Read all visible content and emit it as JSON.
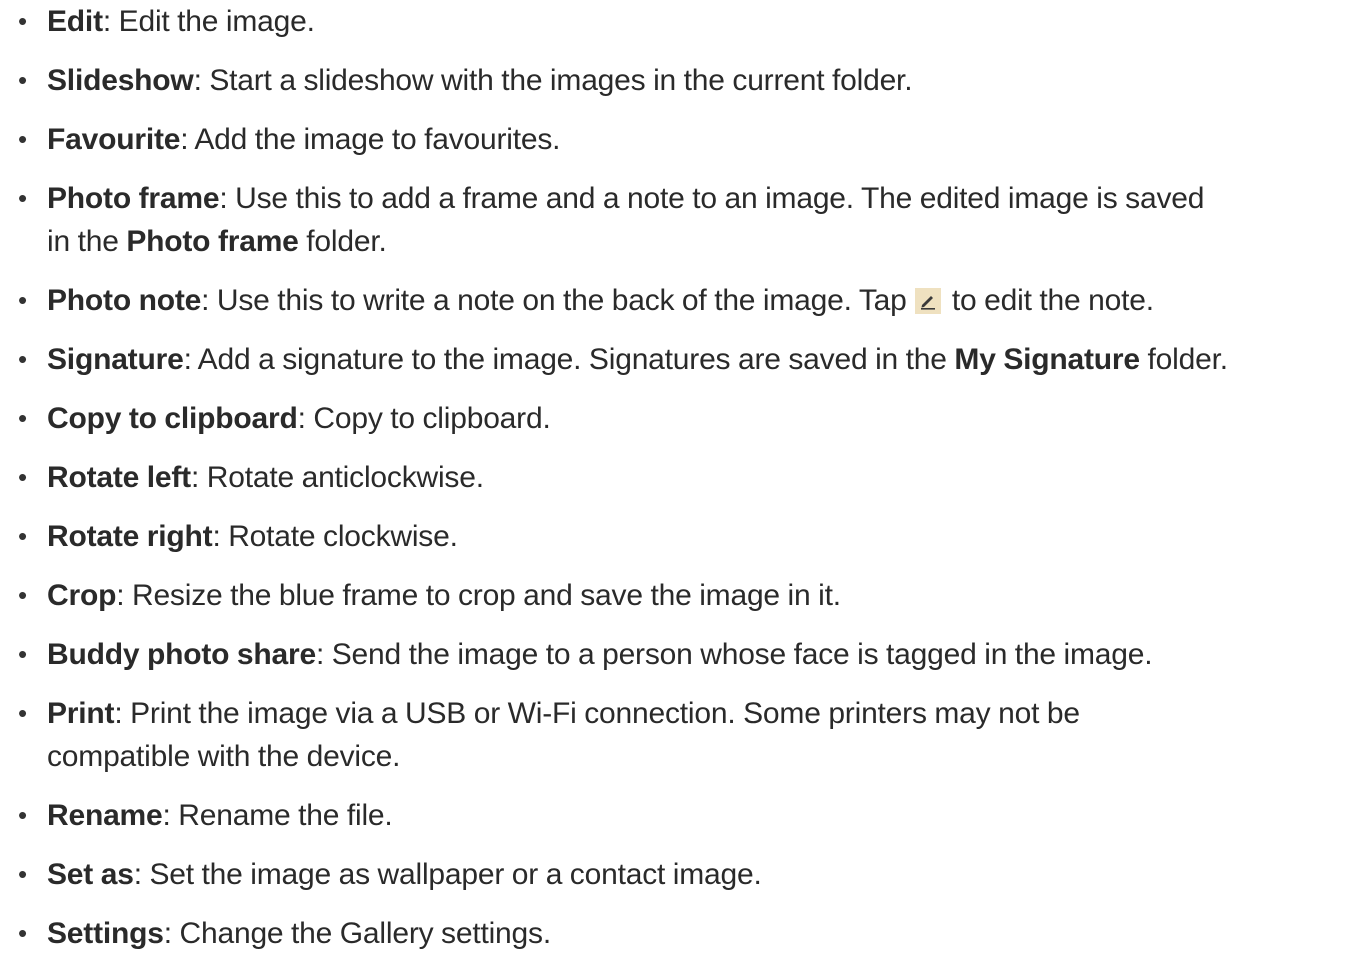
{
  "items": [
    {
      "term": "Edit",
      "desc": ": Edit the image."
    },
    {
      "term": "Slideshow",
      "desc": ": Start a slideshow with the images in the current folder."
    },
    {
      "term": "Favourite",
      "desc": ": Add the image to favourites."
    },
    {
      "term": "Photo frame",
      "desc_a": ": Use this to add a frame and a note to an image. The edited image is saved",
      "desc_b": "in the ",
      "term2": "Photo frame",
      "desc_c": " folder."
    },
    {
      "term": "Photo note",
      "desc_a": ": Use this to write a note on the back of the image. Tap ",
      "icon": "edit-pencil-icon",
      "desc_b": " to edit the note."
    },
    {
      "term": "Signature",
      "desc_a": ": Add a signature to the image. Signatures are saved in the ",
      "term2": "My Signature",
      "desc_b": " folder."
    },
    {
      "term": "Copy to clipboard",
      "desc": ": Copy to clipboard."
    },
    {
      "term": "Rotate left",
      "desc": ": Rotate anticlockwise."
    },
    {
      "term": "Rotate right",
      "desc": ": Rotate clockwise."
    },
    {
      "term": "Crop",
      "desc": ": Resize the blue frame to crop and save the image in it."
    },
    {
      "term": "Buddy photo share",
      "desc": ": Send the image to a person whose face is tagged in the image."
    },
    {
      "term": "Print",
      "desc_a": ": Print the image via a USB or Wi-Fi connection. Some printers may not be",
      "desc_b": "compatible with the device."
    },
    {
      "term": "Rename",
      "desc": ": Rename the file."
    },
    {
      "term": "Set as",
      "desc": ": Set the image as wallpaper or a contact image."
    },
    {
      "term": "Settings",
      "desc": ": Change the Gallery settings."
    }
  ],
  "bullet": "•",
  "colors": {
    "text": "#2a2a2a",
    "icon_bg": "#efe1c0",
    "icon_fg": "#3a3a3a"
  }
}
